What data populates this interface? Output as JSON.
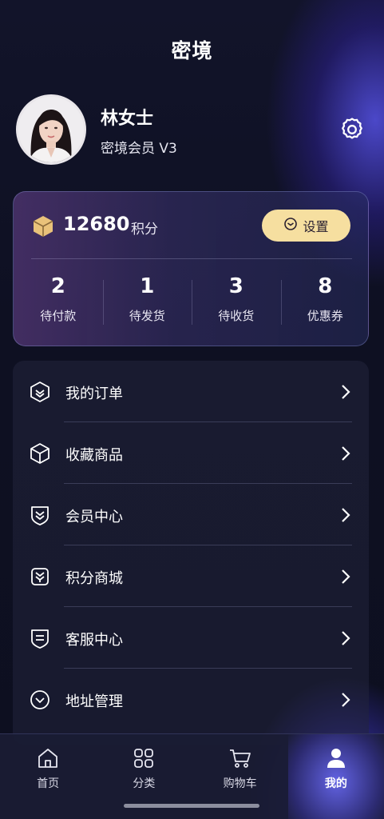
{
  "header": {
    "title": "密境"
  },
  "profile": {
    "name": "林女士",
    "level": "密境会员 V3",
    "settings_icon": "gear-icon"
  },
  "points": {
    "value": "12680",
    "unit": "积分",
    "icon": "coin-box-icon",
    "settings_label": "设置"
  },
  "stats": [
    {
      "count": "2",
      "label": "待付款"
    },
    {
      "count": "1",
      "label": "待发货"
    },
    {
      "count": "3",
      "label": "待收货"
    },
    {
      "count": "8",
      "label": "优惠券"
    }
  ],
  "menu": [
    {
      "label": "我的订单",
      "icon": "order-icon"
    },
    {
      "label": "收藏商品",
      "icon": "favorite-box-icon"
    },
    {
      "label": "会员中心",
      "icon": "member-shield-icon"
    },
    {
      "label": "积分商城",
      "icon": "points-mall-icon"
    },
    {
      "label": "客服中心",
      "icon": "service-icon"
    },
    {
      "label": "地址管理",
      "icon": "address-icon"
    }
  ],
  "tabbar": [
    {
      "label": "首页",
      "icon": "home-icon"
    },
    {
      "label": "分类",
      "icon": "category-icon"
    },
    {
      "label": "购物车",
      "icon": "cart-icon"
    },
    {
      "label": "我的",
      "icon": "user-icon",
      "active": true
    }
  ],
  "colors": {
    "background": "#0e1020",
    "accent_gold": "#f6dfa0",
    "accent_purple": "#6e6eff"
  }
}
